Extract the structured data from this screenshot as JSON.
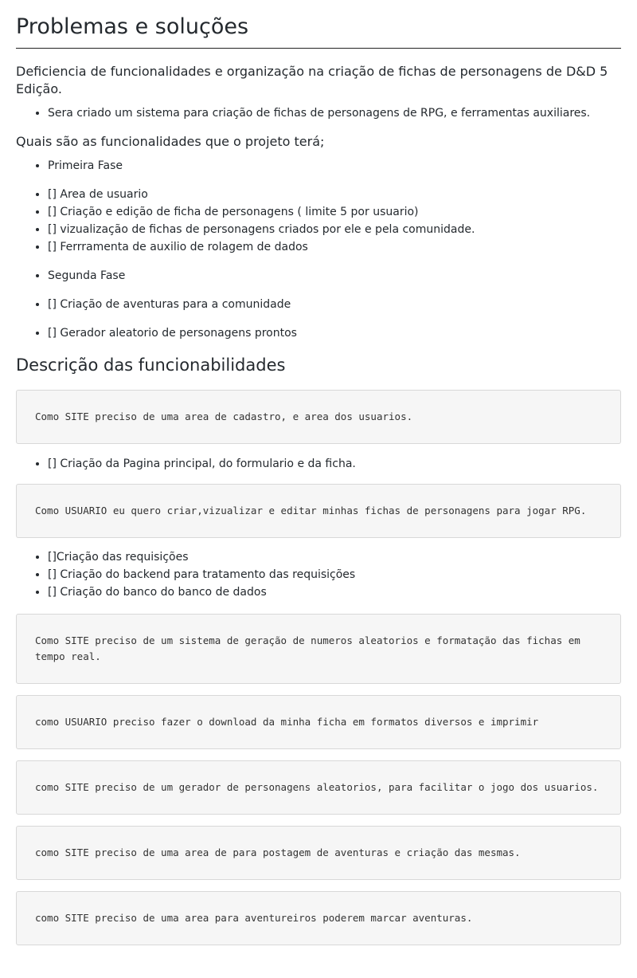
{
  "title": "Problemas e soluções",
  "problem": "Deficiencia de funcionalidades e organização na criação de fichas de personagens de D&D 5 Edição.",
  "solution_items": [
    "Sera criado um sistema para criação de fichas de personagens de RPG, e ferramentas auxiliares."
  ],
  "features_intro": "Quais são as funcionalidades que o projeto terá;",
  "phase1_label": "Primeira Fase",
  "phase1_items": [
    "[] Area de usuario",
    "[] Criação e edição de ficha de personagens ( limite 5 por usuario)",
    "[] vizualização de fichas de personagens criados por ele e pela comunidade.",
    "[] Ferrramenta de auxilio de rolagem de dados"
  ],
  "phase2_label": "Segunda Fase",
  "phase2_items": [
    "[] Criação de aventuras para a comunidade",
    "[] Gerador aleatorio de personagens prontos"
  ],
  "section2_title": "Descrição das funcionabilidades",
  "stories": [
    "Como SITE preciso de uma area de cadastro, e area dos usuarios.",
    "Como USUARIO eu quero criar,vizualizar e editar minhas fichas de personagens para jogar RPG.",
    "Como SITE preciso de um sistema de geração de numeros aleatorios e formatação das fichas em tempo real.",
    "como USUARIO preciso fazer o download da minha ficha em formatos diversos e imprimir",
    "como SITE preciso de um gerador de personagens aleatorios, para facilitar o jogo dos usuarios.",
    "como SITE preciso de uma area de para postagem de aventuras e criação das mesmas.",
    "como SITE preciso de uma area para aventureiros poderem marcar aventuras."
  ],
  "story1_tasks": [
    "[] Criação da Pagina principal, do formulario e da ficha."
  ],
  "story2_tasks": [
    "[]Criação das requisições",
    "[] Criação do backend para tratamento das requisições",
    "[] Criação do banco do banco de dados"
  ]
}
